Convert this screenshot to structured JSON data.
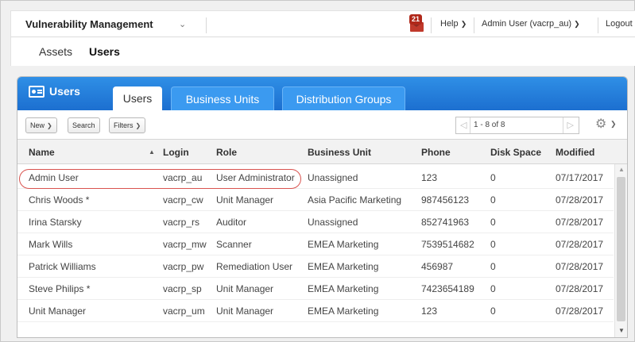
{
  "topbar": {
    "app_title": "Vulnerability Management",
    "notification_count": "21",
    "help_label": "Help",
    "user_label": "Admin User (vacrp_au)",
    "logout_label": "Logout"
  },
  "modules": {
    "assets": "Assets",
    "users": "Users"
  },
  "panel": {
    "title": "Users",
    "tabs": [
      "Users",
      "Business Units",
      "Distribution Groups"
    ]
  },
  "toolbar": {
    "new_label": "New",
    "search_label": "Search",
    "filters_label": "Filters",
    "page_range": "1 - 8 of 8"
  },
  "table": {
    "columns": [
      "Name",
      "Login",
      "Role",
      "Business Unit",
      "Phone",
      "Disk Space",
      "Modified"
    ],
    "rows": [
      [
        "Admin User",
        "vacrp_au",
        "User Administrator",
        "Unassigned",
        "123",
        "0",
        "07/17/2017"
      ],
      [
        "Chris Woods *",
        "vacrp_cw",
        "Unit Manager",
        "Asia Pacific Marketing",
        "987456123",
        "0",
        "07/28/2017"
      ],
      [
        "Irina Starsky",
        "vacrp_rs",
        "Auditor",
        "Unassigned",
        "852741963",
        "0",
        "07/28/2017"
      ],
      [
        "Mark Wills",
        "vacrp_mw",
        "Scanner",
        "EMEA Marketing",
        "7539514682",
        "0",
        "07/28/2017"
      ],
      [
        "Patrick Williams",
        "vacrp_pw",
        "Remediation User",
        "EMEA Marketing",
        "456987",
        "0",
        "07/28/2017"
      ],
      [
        "Steve Philips *",
        "vacrp_sp",
        "Unit Manager",
        "EMEA Marketing",
        "7423654189",
        "0",
        "07/28/2017"
      ],
      [
        "Unit Manager",
        "vacrp_um",
        "Unit Manager",
        "EMEA Marketing",
        "123",
        "0",
        "07/28/2017"
      ]
    ]
  },
  "colors": {
    "panel_header": "#1c6fd0",
    "inactive_tab": "#3b9af0",
    "highlight": "#d9534f",
    "notification": "#c0392b"
  }
}
